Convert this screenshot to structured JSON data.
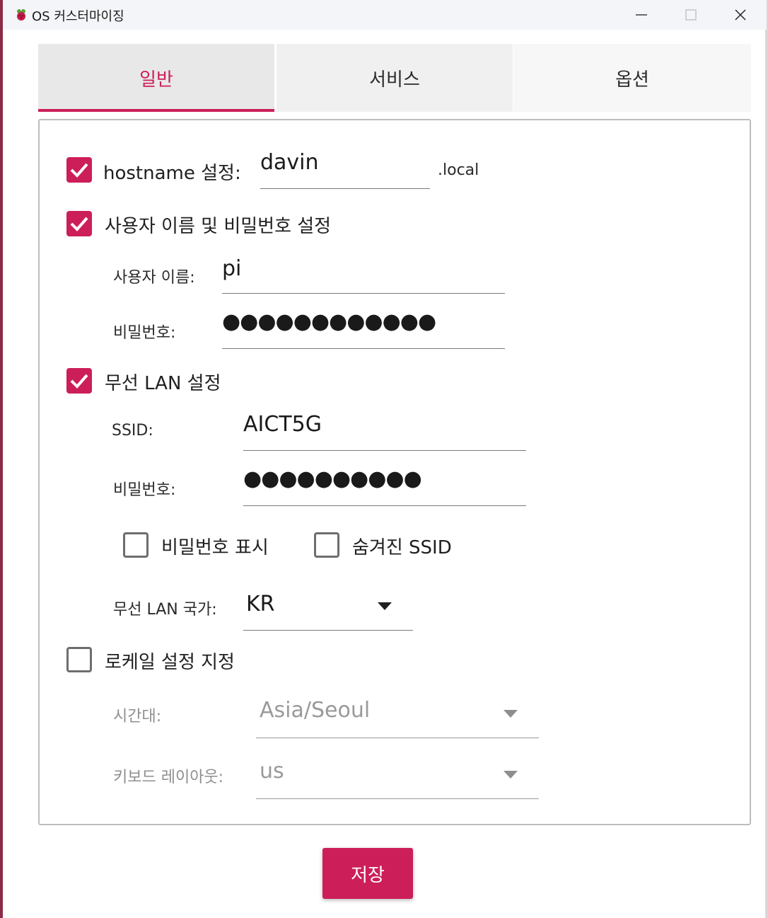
{
  "window": {
    "title": "OS 커스터마이징"
  },
  "tabs": [
    {
      "label": "일반",
      "active": true
    },
    {
      "label": "서비스",
      "active": false
    },
    {
      "label": "옵션",
      "active": false
    }
  ],
  "general": {
    "hostname": {
      "label": "hostname 설정:",
      "checked": true,
      "value": "davin",
      "suffix": ".local"
    },
    "user": {
      "label": "사용자 이름 및 비밀번호 설정",
      "checked": true,
      "username_label": "사용자 이름:",
      "username_value": "pi",
      "password_label": "비밀번호:",
      "password_mask": "●●●●●●●●●●●●"
    },
    "wifi": {
      "label": "무선 LAN 설정",
      "checked": true,
      "ssid_label": "SSID:",
      "ssid_value": "AICT5G",
      "password_label": "비밀번호:",
      "password_mask": "●●●●●●●●●●",
      "show_password_label": "비밀번호 표시",
      "show_password_checked": false,
      "hidden_ssid_label": "숨겨진 SSID",
      "hidden_ssid_checked": false,
      "country_label": "무선 LAN 국가:",
      "country_value": "KR"
    },
    "locale": {
      "label": "로케일 설정 지정",
      "checked": false,
      "timezone_label": "시간대:",
      "timezone_value": "Asia/Seoul",
      "keyboard_label": "키보드 레이아웃:",
      "keyboard_value": "us"
    }
  },
  "save_button": "저장",
  "colors": {
    "accent": "#cc1f5a",
    "disabled_text": "#9a9a9a"
  }
}
